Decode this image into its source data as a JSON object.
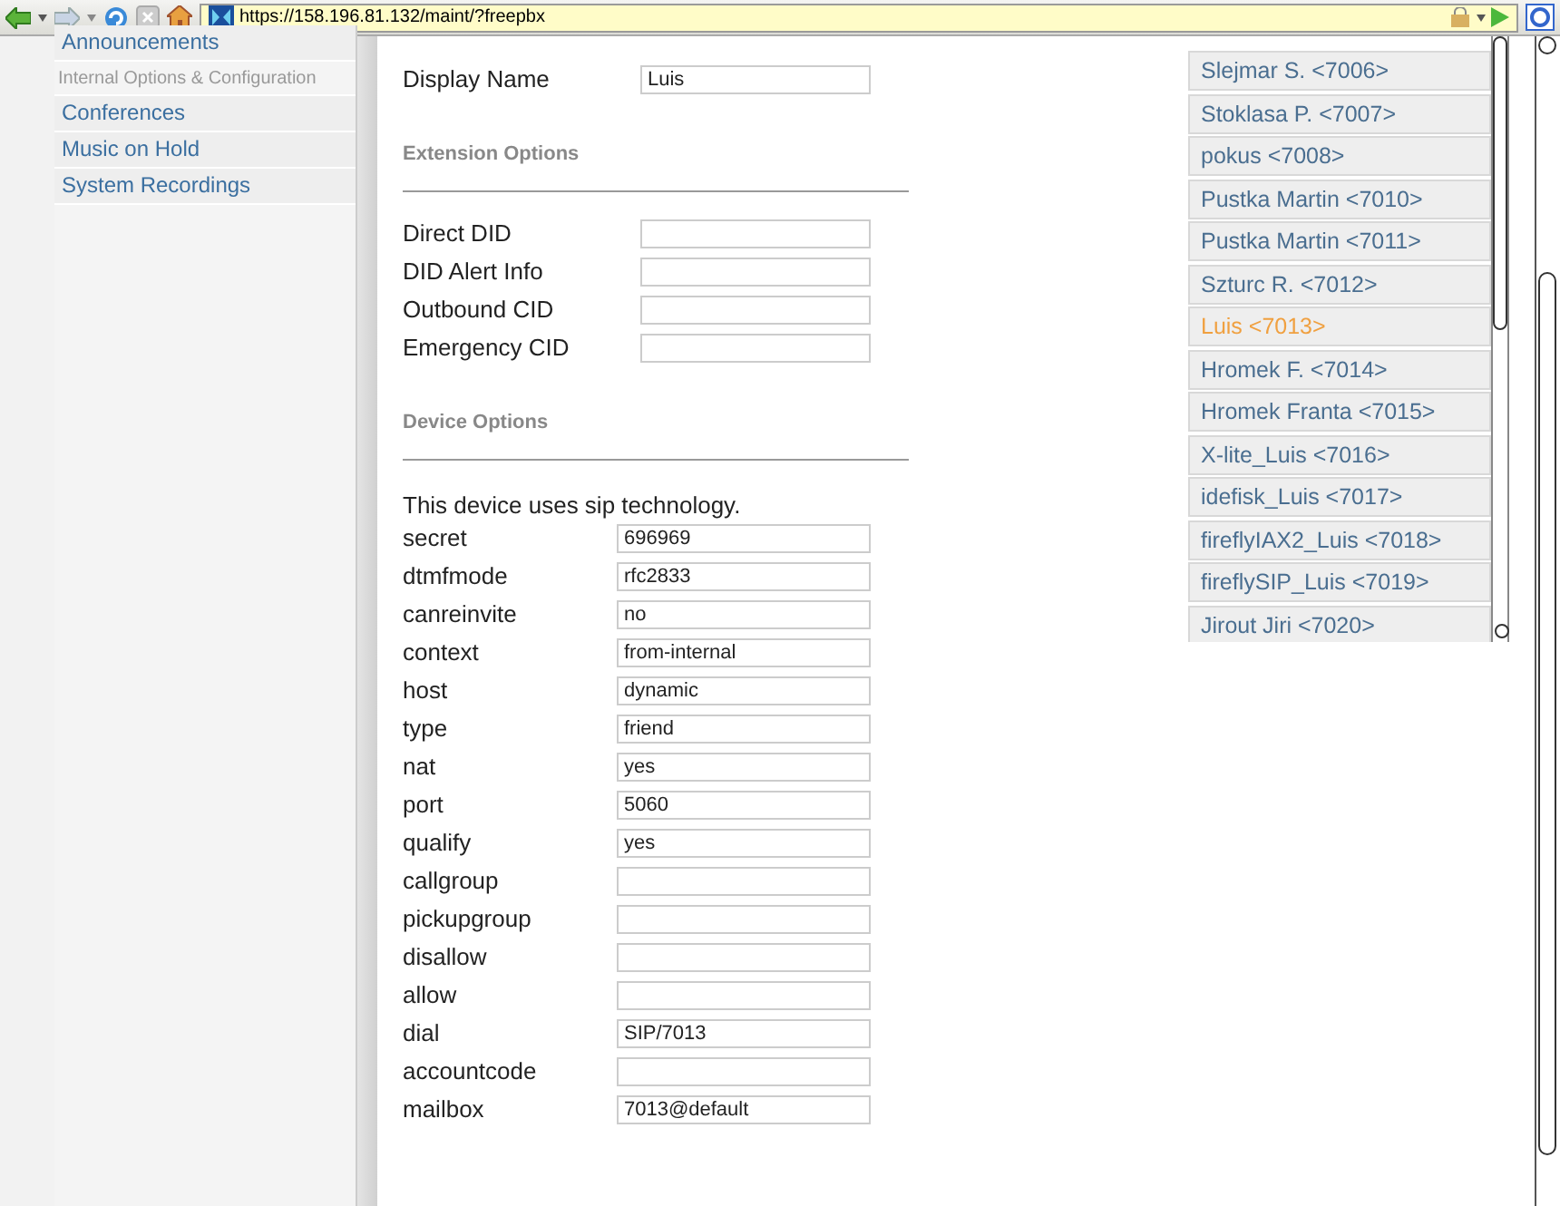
{
  "browser": {
    "url": "https://158.196.81.132/maint/?freepbx"
  },
  "sidebar": {
    "items": [
      {
        "kind": "link",
        "label": "Announcements"
      },
      {
        "kind": "heading",
        "label": "Internal Options & Configuration"
      },
      {
        "kind": "link",
        "label": "Conferences"
      },
      {
        "kind": "link",
        "label": "Music on Hold"
      },
      {
        "kind": "link",
        "label": "System Recordings"
      }
    ]
  },
  "form": {
    "display_name": {
      "label": "Display Name",
      "value": "Luis"
    },
    "sections": [
      {
        "title": "Extension Options",
        "fields": [
          {
            "label": "Direct DID"
          },
          {
            "label": "DID Alert Info"
          },
          {
            "label": "Outbound CID"
          },
          {
            "label": "Emergency CID"
          }
        ]
      },
      {
        "title": "Device Options",
        "note": "This device uses sip technology.",
        "fields": [
          {
            "label": "secret",
            "value": "696969"
          },
          {
            "label": "dtmfmode",
            "value": "rfc2833"
          },
          {
            "label": "canreinvite",
            "value": "no"
          },
          {
            "label": "context",
            "value": "from-internal"
          },
          {
            "label": "host",
            "value": "dynamic"
          },
          {
            "label": "type",
            "value": "friend"
          },
          {
            "label": "nat",
            "value": "yes"
          },
          {
            "label": "port",
            "value": "5060"
          },
          {
            "label": "qualify",
            "value": "yes"
          },
          {
            "label": "callgroup"
          },
          {
            "label": "pickupgroup"
          },
          {
            "label": "disallow"
          },
          {
            "label": "allow"
          },
          {
            "label": "dial",
            "value": "SIP/7013"
          },
          {
            "label": "accountcode"
          },
          {
            "label": "mailbox",
            "value": "7013@default"
          }
        ]
      }
    ]
  },
  "extensions": [
    {
      "label": "Slejmar S. <7006>",
      "selected": false
    },
    {
      "label": "Stoklasa P. <7007>",
      "selected": false
    },
    {
      "label": "pokus <7008>",
      "selected": false
    },
    {
      "label": "Pustka Martin <7010>",
      "selected": false
    },
    {
      "label": "Pustka Martin <7011>",
      "selected": false
    },
    {
      "label": "Szturc R. <7012>",
      "selected": false
    },
    {
      "label": "Luis <7013>",
      "selected": true
    },
    {
      "label": "Hromek F. <7014>",
      "selected": false
    },
    {
      "label": "Hromek Franta <7015>",
      "selected": false
    },
    {
      "label": "X-lite_Luis <7016>",
      "selected": false
    },
    {
      "label": "idefisk_Luis <7017>",
      "selected": false
    },
    {
      "label": "fireflyIAX2_Luis <7018>",
      "selected": false
    },
    {
      "label": "fireflySIP_Luis <7019>",
      "selected": false
    },
    {
      "label": "Jirout Jiri <7020>",
      "selected": false
    }
  ]
}
